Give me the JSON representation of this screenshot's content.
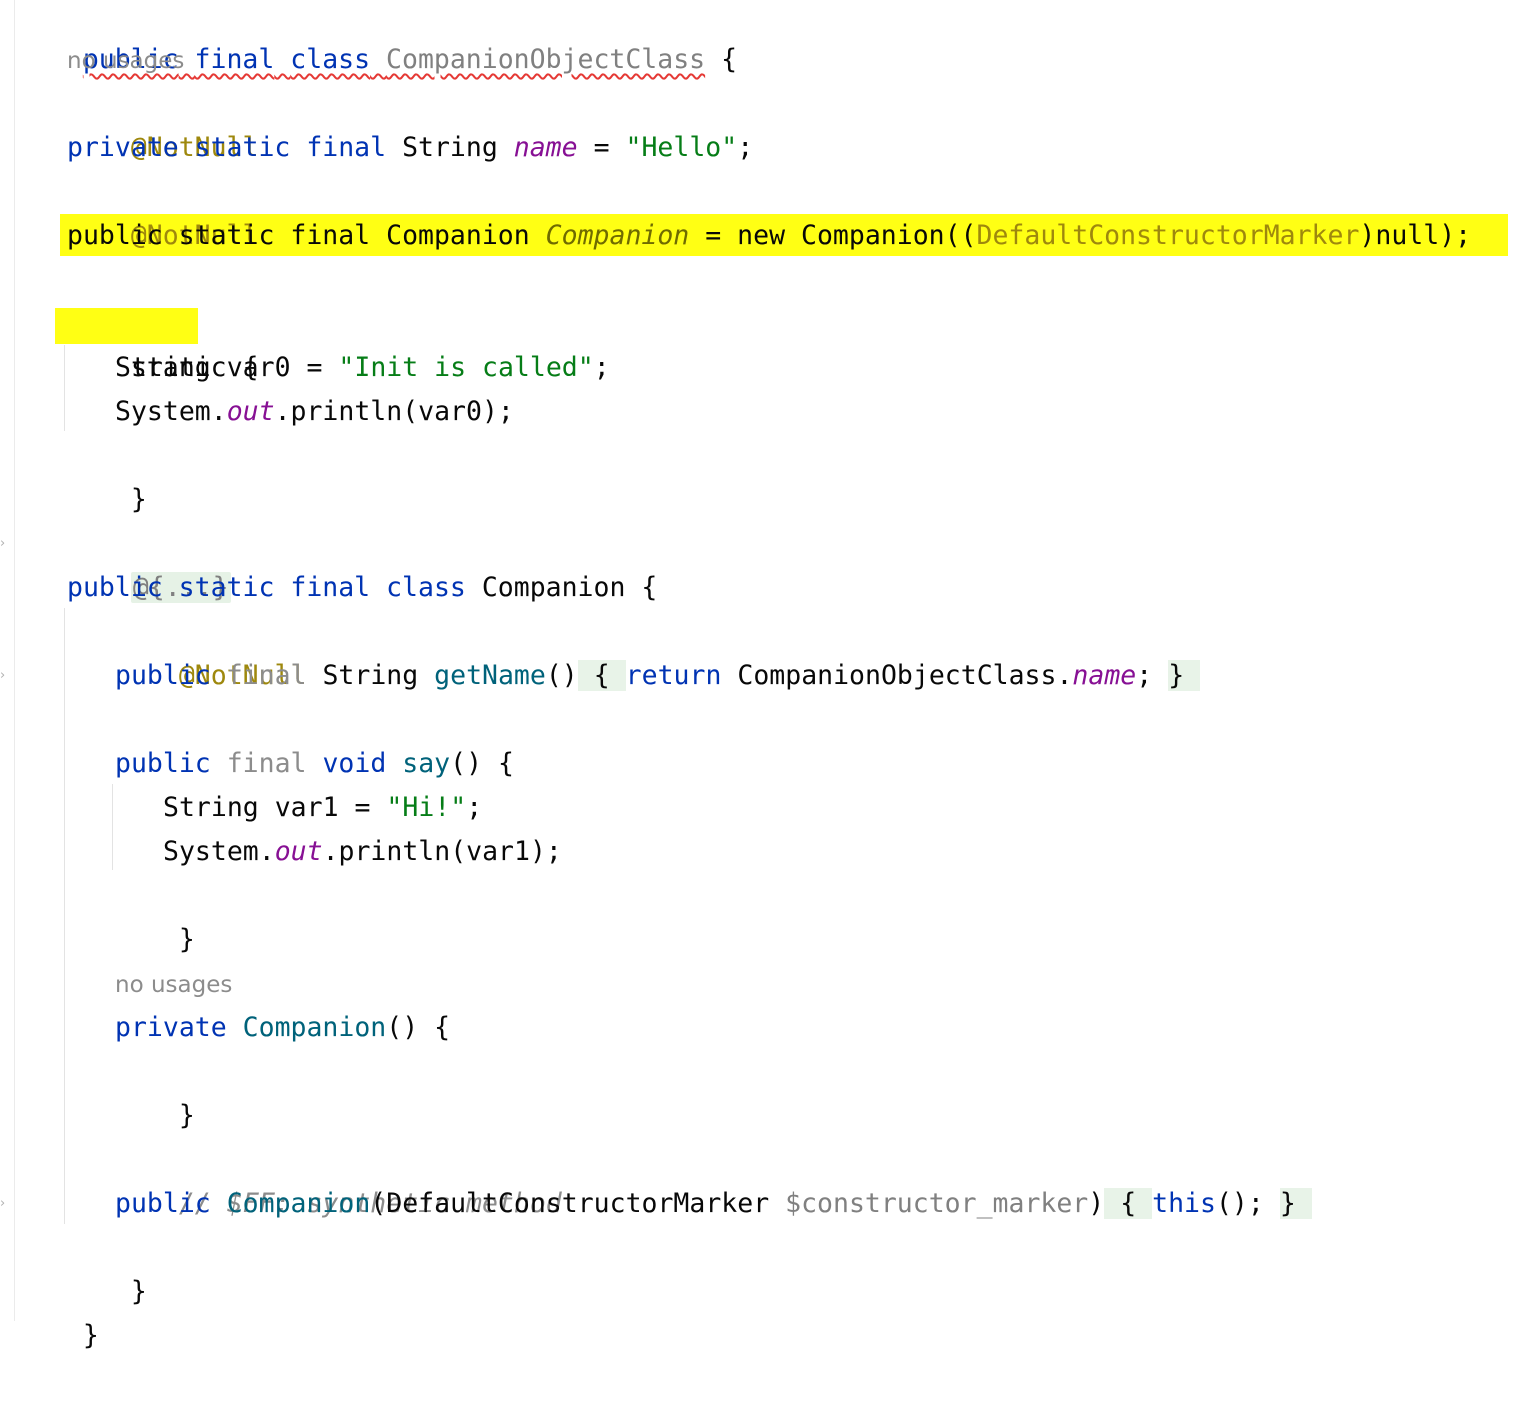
{
  "hints": {
    "no_usages_1": "no usages",
    "no_usages_2": "no usages"
  },
  "code": {
    "l1_kw1": "public",
    "l1_kw2": "final",
    "l1_kw3": "class",
    "l1_name": "CompanionObjectClass",
    "l1_brace": "{",
    "l3_ann": "@NotNull",
    "l4_kw": "private static final",
    "l4_type": "String",
    "l4_field": "name",
    "l4_eq": "=",
    "l4_str": "\"Hello\"",
    "l4_semi": ";",
    "l5_ann": "@NotNull",
    "l6_kw": "public static final",
    "l6_type": "Companion",
    "l6_field": "Companion",
    "l6_eq": "=",
    "l6_new": "new",
    "l6_call": "Companion((",
    "l6_cast": "DefaultConstructorMarker",
    "l6_tail": ")null);",
    "l7_static": "static {",
    "l8_type": "String",
    "l8_var": "var0 =",
    "l8_str": "\"Init is called\"",
    "l8_semi": ";",
    "l9_sys": "System.",
    "l9_out": "out",
    "l9_rest": ".println(var0);",
    "l10_close": "}",
    "l11_fold": "@{...}",
    "l12_kw": "public static final class",
    "l12_name": "Companion",
    "l12_brace": "{",
    "l13_ann": "@NotNull",
    "l14_kw": "public",
    "l14_final": "final",
    "l14_type": "String",
    "l14_fn": "getName",
    "l14_parens": "()",
    "l14_open": "{",
    "l14_ret": "return",
    "l14_cls": "CompanionObjectClass.",
    "l14_field": "name",
    "l14_semi": ";",
    "l14_close": "}",
    "l15_kw": "public",
    "l15_final": "final",
    "l15_void": "void",
    "l15_fn": "say",
    "l15_rest": "() {",
    "l16_type": "String",
    "l16_var": "var1 =",
    "l16_str": "\"Hi!\"",
    "l16_semi": ";",
    "l17_sys": "System.",
    "l17_out": "out",
    "l17_rest": ".println(var1);",
    "l18_close": "}",
    "l19_kw": "private",
    "l19_fn": "Companion",
    "l19_rest": "() {",
    "l20_close": "}",
    "l21_comment": "// $FF: synthetic method",
    "l22_kw": "public",
    "l22_fn": "Companion",
    "l22_sig": "(DefaultConstructorMarker",
    "l22_param": "$constructor_marker",
    "l22_paren": ")",
    "l22_open": "{",
    "l22_this": "this",
    "l22_call": "();",
    "l22_close": "}",
    "l23_close": "}",
    "l24_close": "}"
  },
  "colors": {
    "keyword": "#0033b3",
    "annotation": "#9e880d",
    "string": "#067d17",
    "field": "#871094",
    "function": "#00627a",
    "highlight": "#ffff00",
    "error_squiggle": "#e53935"
  }
}
